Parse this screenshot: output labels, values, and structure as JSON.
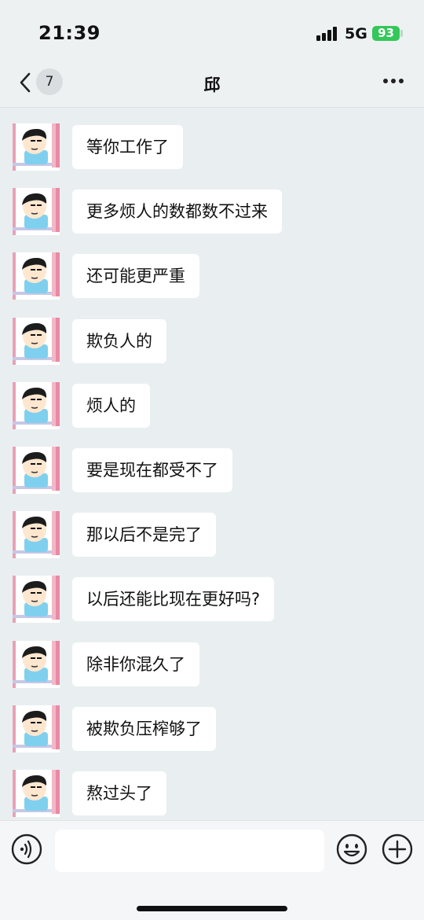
{
  "status_bar": {
    "time": "21:39",
    "network": "5G",
    "battery": "93"
  },
  "header": {
    "back_count": "7",
    "title": "邱"
  },
  "colors": {
    "battery": "#34c759",
    "bubble": "#ffffff",
    "background": "#e9eff1"
  },
  "icons": {
    "back": "chevron-left-icon",
    "more": "more-horizontal-icon",
    "voice": "voice-icon",
    "emoji": "emoji-icon",
    "plus": "plus-icon"
  },
  "messages": [
    {
      "text": "等你工作了"
    },
    {
      "text": "更多烦人的数都数不过来"
    },
    {
      "text": "还可能更严重"
    },
    {
      "text": "欺负人的"
    },
    {
      "text": "烦人的"
    },
    {
      "text": "要是现在都受不了"
    },
    {
      "text": "那以后不是完了"
    },
    {
      "text": "以后还能比现在更好吗?"
    },
    {
      "text": "除非你混久了"
    },
    {
      "text": "被欺负压榨够了"
    },
    {
      "text": "熬过头了"
    }
  ],
  "input": {
    "value": ""
  }
}
